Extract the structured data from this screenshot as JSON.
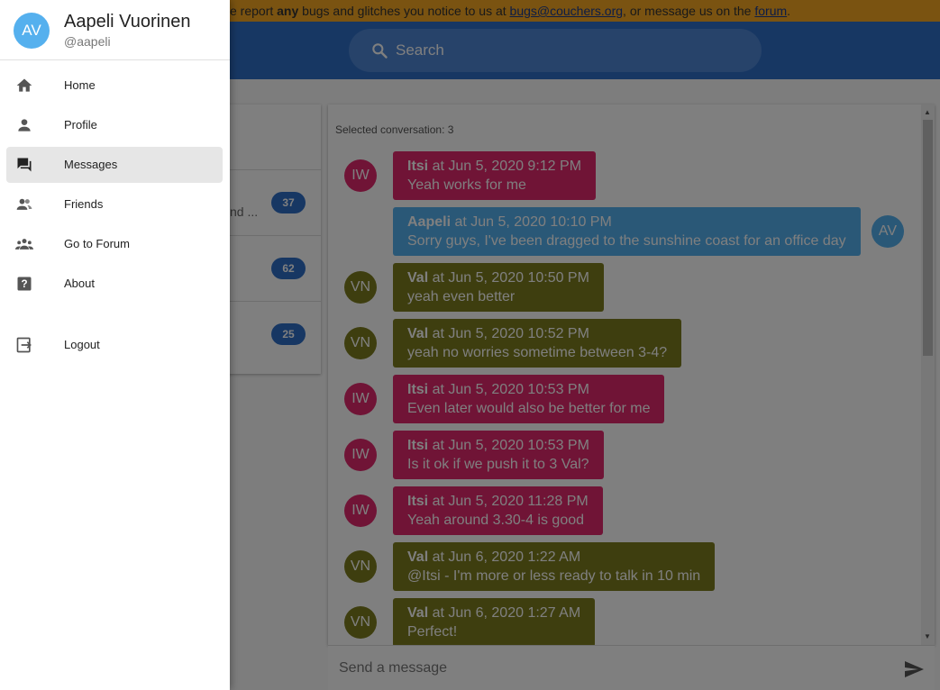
{
  "banner": {
    "prefix": "e report ",
    "bold": "any",
    "middle": " bugs and glitches you notice to us at ",
    "email": "bugs@couchers.org",
    "suffix": ", or message us on the ",
    "forum": "forum",
    "end": "."
  },
  "search": {
    "placeholder": "Search",
    "icon": "search-icon"
  },
  "conversations": [
    {
      "snippet": "nd ...",
      "unread": "37"
    },
    {
      "snippet": "",
      "unread": "62"
    },
    {
      "snippet": "",
      "unread": "25"
    }
  ],
  "messages_panel": {
    "selected_label": "Selected conversation: 3",
    "composer_placeholder": "Send a message"
  },
  "messages": [
    {
      "initials": "IW",
      "author": "Itsi",
      "time": " at Jun 5, 2020 9:12 PM",
      "text": "Yeah works for me",
      "style": "iw",
      "side": "left"
    },
    {
      "initials": "AV",
      "author": "Aapeli",
      "time": " at Jun 5, 2020 10:10 PM",
      "text": "Sorry guys, I've been dragged to the sunshine coast for an office day",
      "style": "av",
      "side": "right"
    },
    {
      "initials": "VN",
      "author": "Val",
      "time": " at Jun 5, 2020 10:50 PM",
      "text": "yeah even better",
      "style": "vn",
      "side": "left"
    },
    {
      "initials": "VN",
      "author": "Val",
      "time": " at Jun 5, 2020 10:52 PM",
      "text": "yeah no worries sometime between 3-4?",
      "style": "vn",
      "side": "left"
    },
    {
      "initials": "IW",
      "author": "Itsi",
      "time": " at Jun 5, 2020 10:53 PM",
      "text": "Even later would also be better for me",
      "style": "iw",
      "side": "left"
    },
    {
      "initials": "IW",
      "author": "Itsi",
      "time": " at Jun 5, 2020 10:53 PM",
      "text": "Is it ok if we push it to 3 Val?",
      "style": "iw",
      "side": "left"
    },
    {
      "initials": "IW",
      "author": "Itsi",
      "time": " at Jun 5, 2020 11:28 PM",
      "text": "Yeah around 3.30-4 is good",
      "style": "iw",
      "side": "left"
    },
    {
      "initials": "VN",
      "author": "Val",
      "time": " at Jun 6, 2020 1:22 AM",
      "text": "@Itsi - I'm more or less ready to talk in 10 min",
      "style": "vn",
      "side": "left"
    },
    {
      "initials": "VN",
      "author": "Val",
      "time": " at Jun 6, 2020 1:27 AM",
      "text": "Perfect!",
      "style": "vn",
      "side": "left"
    }
  ],
  "drawer": {
    "user": {
      "initials": "AV",
      "name": "Aapeli Vuorinen",
      "handle": "@aapeli"
    },
    "items": [
      {
        "label": "Home",
        "icon": "home-icon",
        "active": false
      },
      {
        "label": "Profile",
        "icon": "person-icon",
        "active": false
      },
      {
        "label": "Messages",
        "icon": "chat-icon",
        "active": true
      },
      {
        "label": "Friends",
        "icon": "friends-icon",
        "active": false
      },
      {
        "label": "Go to Forum",
        "icon": "group-icon",
        "active": false
      },
      {
        "label": "About",
        "icon": "help-icon",
        "active": false
      },
      {
        "label": "Logout",
        "icon": "logout-icon",
        "active": false
      }
    ]
  },
  "colors": {
    "banner": "#f5a623",
    "appbar": "#2f6fc7",
    "itsi": "#e0286c",
    "val": "#7d7d1e",
    "aapeli": "#55b0ee"
  }
}
